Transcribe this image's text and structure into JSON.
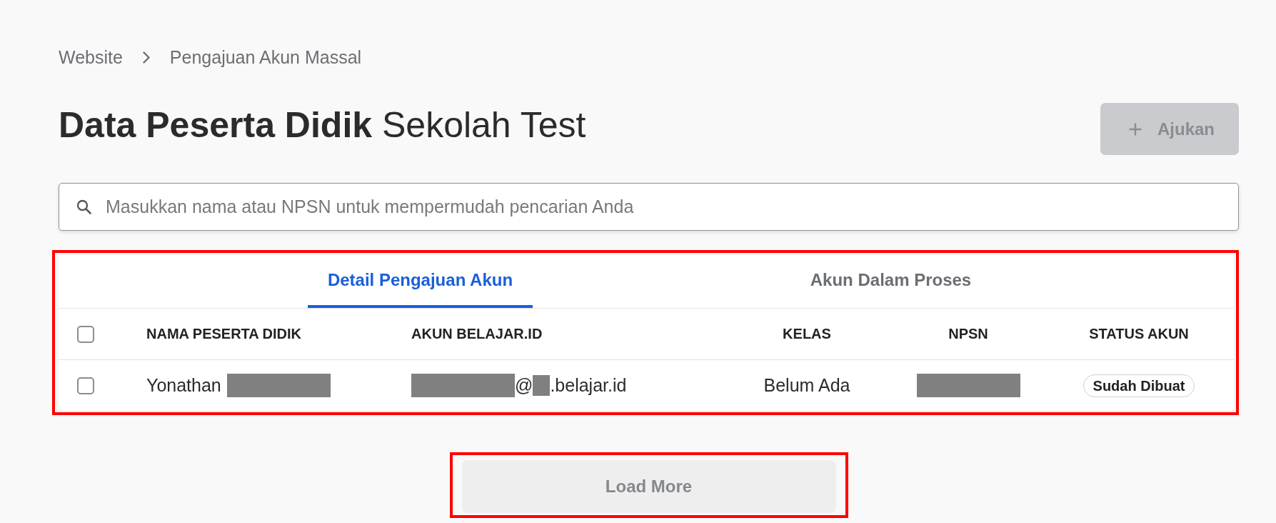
{
  "breadcrumb": [
    {
      "label": "Website"
    },
    {
      "label": "Pengajuan Akun Massal"
    }
  ],
  "page_title": "**Data Peserta Didik** Sekolah Test",
  "add_button": {
    "label": "Ajukan",
    "disabled": true
  },
  "search": {
    "placeholder": "Masukkan nama atau NPSN untuk mempermudah pencarian Anda"
  },
  "table": {
    "highlighted": true,
    "tabs": [
      {
        "label": "Detail Pengajuan Akun",
        "selected": true
      },
      {
        "label": "Akun Dalam Proses",
        "selected": false
      }
    ],
    "select_all": {
      "checked": false
    },
    "columns": [
      "NAMA PESERTA DIDIK",
      "AKUN BELAJAR.ID",
      "KELAS",
      "NPSN",
      "STATUS AKUN"
    ],
    "rows": [
      {
        "checked": false,
        "cells": [
          [
            {
              "kind": "text",
              "text": "Yonathan"
            },
            {
              "kind": "redacted"
            }
          ],
          [
            {
              "kind": "redacted"
            },
            {
              "kind": "text",
              "text": "@"
            },
            {
              "kind": "redacted_short"
            },
            {
              "kind": "text",
              "text": ".belajar.id"
            }
          ],
          [
            {
              "kind": "text",
              "text": "Belum Ada"
            }
          ],
          [
            {
              "kind": "redacted"
            }
          ],
          [
            {
              "kind": "badge",
              "text": "Sudah Dibuat"
            }
          ]
        ]
      }
    ]
  },
  "load_more": {
    "label": "Load More",
    "disabled": true,
    "highlighted": true
  }
}
